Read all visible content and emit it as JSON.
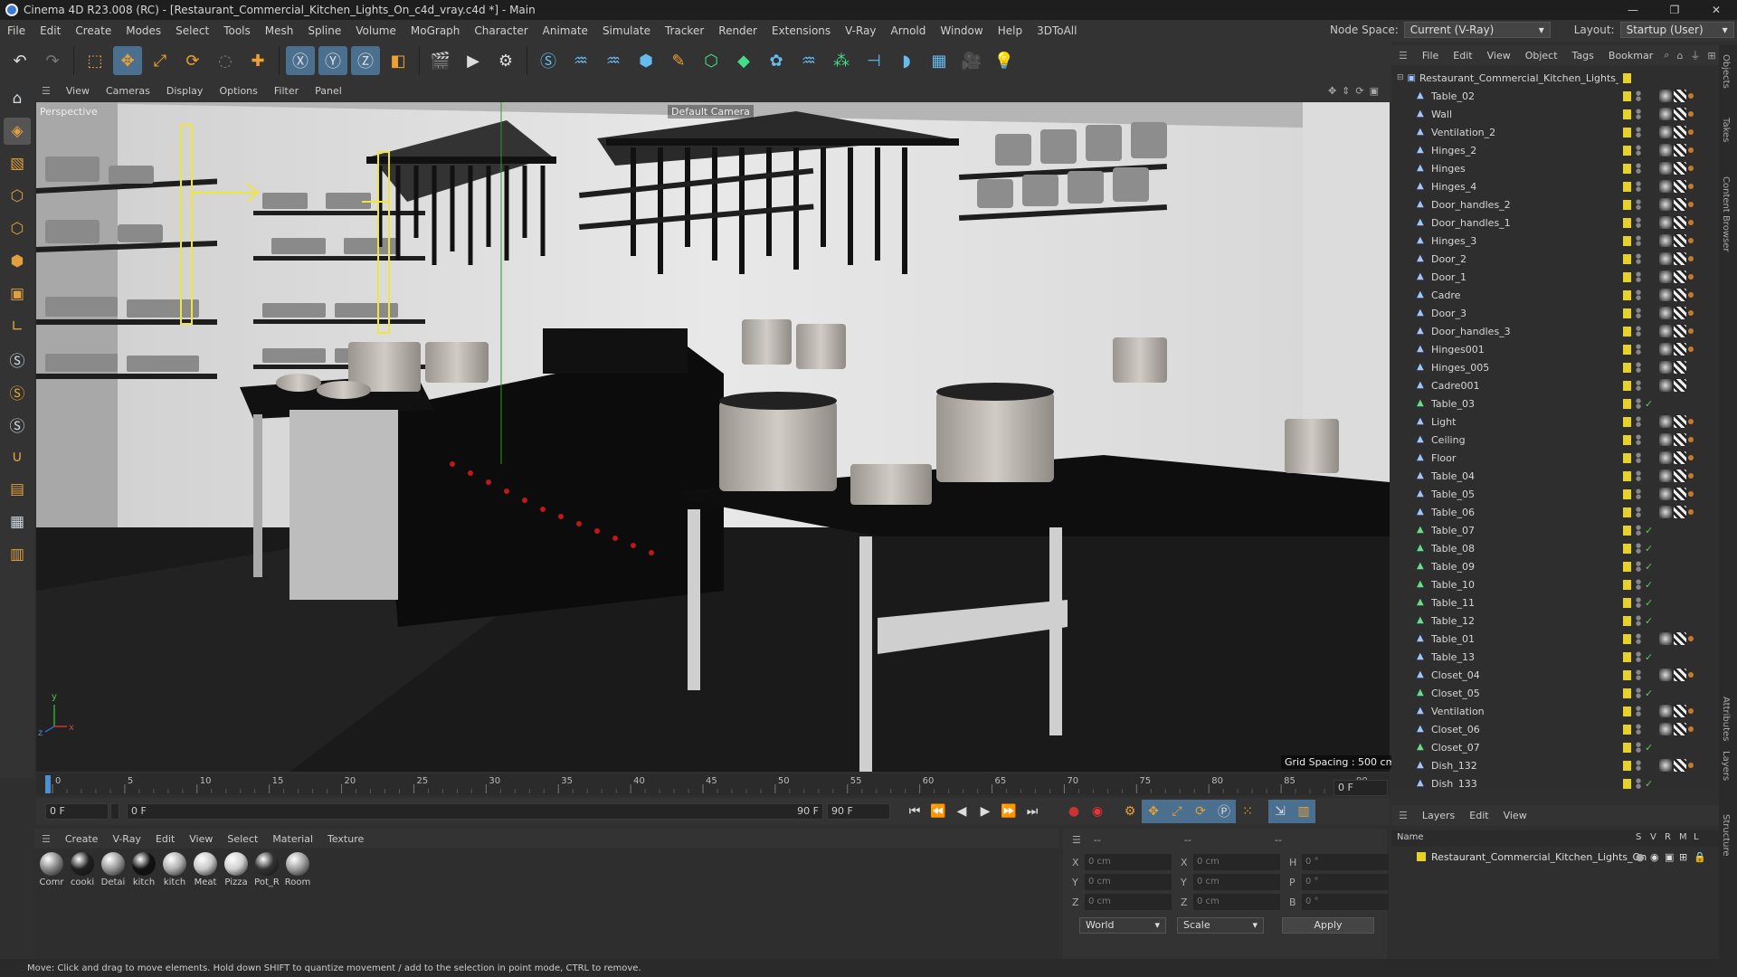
{
  "window": {
    "title": "Cinema 4D R23.008 (RC) - [Restaurant_Commercial_Kitchen_Lights_On_c4d_vray.c4d *] - Main",
    "controls": [
      "—",
      "❐",
      "✕"
    ]
  },
  "menu": [
    "File",
    "Edit",
    "Create",
    "Modes",
    "Select",
    "Tools",
    "Mesh",
    "Spline",
    "Volume",
    "MoGraph",
    "Character",
    "Animate",
    "Simulate",
    "Tracker",
    "Render",
    "Extensions",
    "V-Ray",
    "Arnold",
    "Window",
    "Help",
    "3DToAll"
  ],
  "node_space": {
    "label": "Node Space:",
    "value": "Current (V-Ray)"
  },
  "layout": {
    "label": "Layout:",
    "value": "Startup (User)"
  },
  "viewport": {
    "menu": [
      "View",
      "Cameras",
      "Display",
      "Options",
      "Filter",
      "Panel"
    ],
    "label": "Perspective",
    "camera": "Default Camera",
    "grid_spacing": "Grid Spacing : 500 cm"
  },
  "timeline": {
    "ticks": [
      "0",
      "5",
      "10",
      "15",
      "20",
      "25",
      "30",
      "35",
      "40",
      "45",
      "50",
      "55",
      "60",
      "65",
      "70",
      "75",
      "80",
      "85",
      "90"
    ],
    "current_frame": "0 F",
    "start": "0 F",
    "range_start": "0 F",
    "range_end": "90 F",
    "end": "90 F",
    "right_field": "0 F"
  },
  "materials": {
    "menu": [
      "Create",
      "V-Ray",
      "Edit",
      "View",
      "Select",
      "Material",
      "Texture"
    ],
    "items": [
      {
        "label": "Comr",
        "color": "#8a8a8a"
      },
      {
        "label": "cooki",
        "color": "#202020"
      },
      {
        "label": "Detai",
        "color": "#9a9a9a"
      },
      {
        "label": "kitch",
        "color": "#111111"
      },
      {
        "label": "kitch",
        "color": "#b0b0b0"
      },
      {
        "label": "Meat",
        "color": "#c8c8c8"
      },
      {
        "label": "Pizza",
        "color": "#d0d0d0"
      },
      {
        "label": "Pot_R",
        "color": "#333333"
      },
      {
        "label": "Room",
        "color": "#a0a0a0"
      }
    ]
  },
  "attributes": {
    "header1": "--",
    "header2": "--",
    "header3": "--",
    "rows": [
      {
        "a": "X",
        "av": "0 cm",
        "b": "X",
        "bv": "0 cm",
        "c": "H",
        "cv": "0 °"
      },
      {
        "a": "Y",
        "av": "0 cm",
        "b": "Y",
        "bv": "0 cm",
        "c": "P",
        "cv": "0 °"
      },
      {
        "a": "Z",
        "av": "0 cm",
        "b": "Z",
        "bv": "0 cm",
        "c": "B",
        "cv": "0 °"
      }
    ],
    "coord_mode": "World",
    "scale_mode": "Scale",
    "apply": "Apply"
  },
  "status": "Move: Click and drag to move elements. Hold down SHIFT to quantize movement / add to the selection in point mode, CTRL to remove.",
  "objects": {
    "menu": [
      "File",
      "Edit",
      "View",
      "Object",
      "Tags",
      "Bookmar"
    ],
    "root": "Restaurant_Commercial_Kitchen_Lights_On",
    "items": [
      {
        "name": "Table_02",
        "tags": 3
      },
      {
        "name": "Wall",
        "tags": 3
      },
      {
        "name": "Ventilation_2",
        "tags": 3
      },
      {
        "name": "Hinges_2",
        "tags": 3
      },
      {
        "name": "Hinges",
        "tags": 3
      },
      {
        "name": "Hinges_4",
        "tags": 3
      },
      {
        "name": "Door_handles_2",
        "tags": 3
      },
      {
        "name": "Door_handles_1",
        "tags": 3
      },
      {
        "name": "Hinges_3",
        "tags": 3
      },
      {
        "name": "Door_2",
        "tags": 3
      },
      {
        "name": "Door_1",
        "tags": 3
      },
      {
        "name": "Cadre",
        "tags": 3
      },
      {
        "name": "Door_3",
        "tags": 3
      },
      {
        "name": "Door_handles_3",
        "tags": 3
      },
      {
        "name": "Hinges001",
        "tags": 3
      },
      {
        "name": "Hinges_005",
        "tags": 2
      },
      {
        "name": "Cadre001",
        "tags": 2
      },
      {
        "name": "Table_03",
        "tags": 0,
        "check": true,
        "green": true
      },
      {
        "name": "Light",
        "tags": 3
      },
      {
        "name": "Ceiling",
        "tags": 3
      },
      {
        "name": "Floor",
        "tags": 3
      },
      {
        "name": "Table_04",
        "tags": 3
      },
      {
        "name": "Table_05",
        "tags": 3
      },
      {
        "name": "Table_06",
        "tags": 3
      },
      {
        "name": "Table_07",
        "tags": 0,
        "check": true,
        "green": true
      },
      {
        "name": "Table_08",
        "tags": 0,
        "check": true,
        "green": true
      },
      {
        "name": "Table_09",
        "tags": 0,
        "check": true,
        "green": true
      },
      {
        "name": "Table_10",
        "tags": 0,
        "check": true,
        "green": true
      },
      {
        "name": "Table_11",
        "tags": 0,
        "check": true,
        "green": true
      },
      {
        "name": "Table_12",
        "tags": 0,
        "check": true,
        "green": true
      },
      {
        "name": "Table_01",
        "tags": 3
      },
      {
        "name": "Table_13",
        "tags": 0,
        "check": true
      },
      {
        "name": "Closet_04",
        "tags": 3
      },
      {
        "name": "Closet_05",
        "tags": 0,
        "check": true,
        "green": true
      },
      {
        "name": "Ventilation",
        "tags": 3
      },
      {
        "name": "Closet_06",
        "tags": 3
      },
      {
        "name": "Closet_07",
        "tags": 0,
        "check": true,
        "green": true
      },
      {
        "name": "Dish_132",
        "tags": 3
      },
      {
        "name": "Dish_133",
        "tags": 0,
        "check": true
      }
    ]
  },
  "layers": {
    "menu": [
      "Layers",
      "Edit",
      "View"
    ],
    "cols": {
      "name": "Name",
      "s": "S",
      "v": "V",
      "r": "R",
      "m": "M",
      "l": "L"
    },
    "item": "Restaurant_Commercial_Kitchen_Lights_On"
  },
  "side_tabs": [
    "Objects",
    "Takes",
    "Content Browser",
    "Attributes",
    "Layers",
    "Structure"
  ]
}
